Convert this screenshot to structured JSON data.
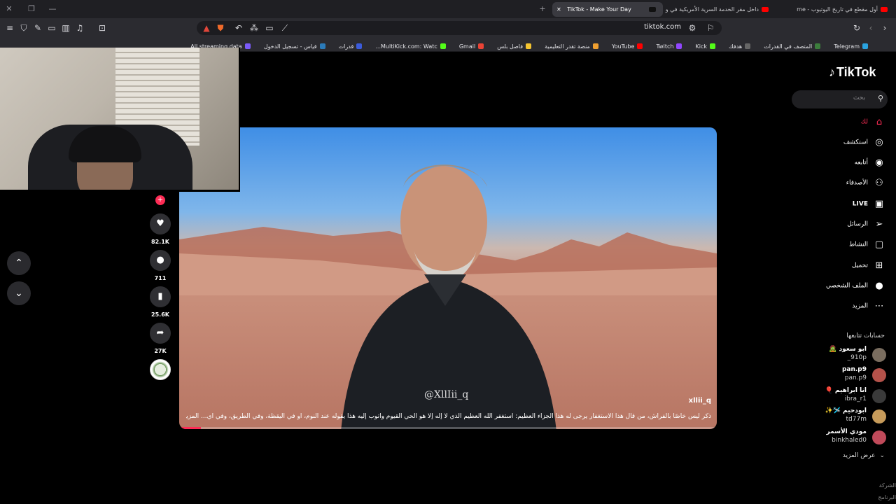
{
  "browser": {
    "tabs": [
      {
        "label": "أول مقطع في تاريخ اليوتيوب - me",
        "active": false
      },
      {
        "label": "داخل مقر الخدمة السرية الأمريكية في و",
        "active": false
      },
      {
        "label": "TikTok - Make Your Day",
        "active": true
      }
    ],
    "url": "tiktok.com",
    "bookmarks": [
      {
        "label": "Telegram",
        "color": "#2aa3e0"
      },
      {
        "label": "المتصف في القدرات",
        "color": "#3c7d3c"
      },
      {
        "label": "هدفك",
        "color": "#555555"
      },
      {
        "label": "Kick",
        "color": "#53fc18"
      },
      {
        "label": "Twitch",
        "color": "#9146ff"
      },
      {
        "label": "YouTube",
        "color": "#ff0000"
      },
      {
        "label": "منصة تقدر التعليمية",
        "color": "#f0a030"
      },
      {
        "label": "فاصل بلس",
        "color": "#f4c430"
      },
      {
        "label": "Gmail",
        "color": "#ea4335"
      },
      {
        "label": "MultiKick.com: Watc...",
        "color": "#53fc18"
      },
      {
        "label": "قدرات",
        "color": "#3b5bdb"
      },
      {
        "label": "قياس - تسجيل الدخول",
        "color": "#2b7bb9"
      },
      {
        "label": "All streaming data...",
        "color": "#7a5af8"
      }
    ]
  },
  "sidebar": {
    "logo": "TikTok",
    "search_placeholder": "بحث",
    "nav": [
      {
        "label": "لك",
        "icon": "home-icon",
        "active": true
      },
      {
        "label": "استكشف",
        "icon": "compass-icon",
        "active": false
      },
      {
        "label": "أتابعه",
        "icon": "following-avatar-icon",
        "active": false
      },
      {
        "label": "الأصدقاء",
        "icon": "friends-icon",
        "active": false
      },
      {
        "label": "LIVE",
        "icon": "live-icon",
        "active": false
      },
      {
        "label": "الرسائل",
        "icon": "send-icon",
        "active": false
      },
      {
        "label": "النشاط",
        "icon": "activity-icon",
        "active": false
      },
      {
        "label": "تحميل",
        "icon": "upload-icon",
        "active": false
      },
      {
        "label": "الملف الشخصي",
        "icon": "profile-avatar-icon",
        "active": false
      },
      {
        "label": "المزيد",
        "icon": "more-icon",
        "active": false
      }
    ],
    "following_title": "حسابات تتابعها",
    "following": [
      {
        "name": "ابو سعود 🧟",
        "handle": "910p_",
        "color": "#7a6d5f"
      },
      {
        "name": "pan.p9",
        "handle": "pan.p9",
        "color": "#b4524a"
      },
      {
        "name": "انا ابراهيم 🎈",
        "handle": "ibra_r1",
        "color": "#3a3a3a"
      },
      {
        "name": "ابودحيم 🛩️✨",
        "handle": "td77m",
        "color": "#c79b5a"
      },
      {
        "name": "مودي الأسمر",
        "handle": "binkhaled0",
        "color": "#c04a5a"
      }
    ],
    "see_more": "عرض المزيد",
    "footer": [
      "الشركة",
      "البرنامج"
    ]
  },
  "video": {
    "watermark": "@XllIii_q",
    "username": "xllii_q",
    "caption": "ذكر ليس خاصًا بالفراش، من قال هذا الاستغفار يرجى له هذا الجزاء العظيم: أستغفر الله العظيم الذي لا إله إلا هو الحي القيوم وأتوب إليه هذا يقوله عند النوم، أو في اليقظة، وفي الطريق، وفي أي... المزيد",
    "progress": 0.04
  },
  "actions": {
    "likes": "82.1K",
    "comments": "711",
    "saves": "25.6K",
    "shares": "27K"
  }
}
